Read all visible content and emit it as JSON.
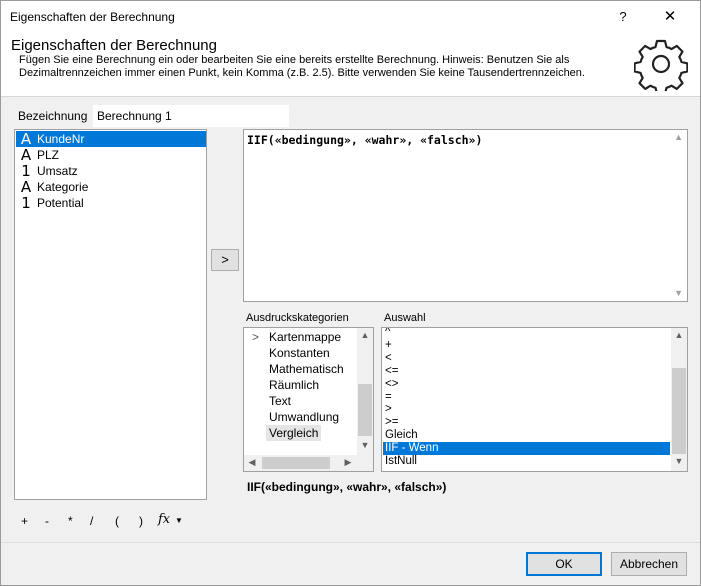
{
  "window": {
    "title": "Eigenschaften der Berechnung",
    "help": "?",
    "close": "✕"
  },
  "header": {
    "title": "Eigenschaften der Berechnung",
    "description": "Fügen Sie eine Berechnung ein oder bearbeiten Sie eine bereits erstellte Berechnung. Hinweis: Benutzen Sie als Dezimaltrennzeichen immer einen Punkt, kein Komma (z.B. 2.5). Bitte verwenden Sie keine Tausendertrennzeichen."
  },
  "name": {
    "label": "Bezeichnung",
    "value": "Berechnung 1"
  },
  "fields": [
    {
      "icon": "A",
      "label": "KundeNr",
      "selected": true
    },
    {
      "icon": "A",
      "label": "PLZ",
      "selected": false
    },
    {
      "icon": "1",
      "label": "Umsatz",
      "selected": false
    },
    {
      "icon": "A",
      "label": "Kategorie",
      "selected": false
    },
    {
      "icon": "1",
      "label": "Potential",
      "selected": false
    }
  ],
  "insert_button": ">",
  "expression": "IIF(«bedingung», «wahr», «falsch»)",
  "categories": {
    "label": "Ausdruckskategorien",
    "items": [
      "Kartenmappe",
      "Konstanten",
      "Mathematisch",
      "Räumlich",
      "Text",
      "Umwandlung",
      "Vergleich"
    ],
    "selected": "Vergleich"
  },
  "selection": {
    "label": "Auswahl",
    "items": [
      "^",
      "+",
      "<",
      "<=",
      "<>",
      "=",
      ">",
      ">=",
      "Gleich",
      "IIF - Wenn",
      "IstNull"
    ],
    "selected": "IIF - Wenn"
  },
  "syntax": "IIF(«bedingung», «wahr», «falsch»)",
  "operators": [
    "+",
    "-",
    "*",
    "/",
    "(",
    ")"
  ],
  "fx_label": "fx",
  "buttons": {
    "ok": "OK",
    "cancel": "Abbrechen"
  }
}
